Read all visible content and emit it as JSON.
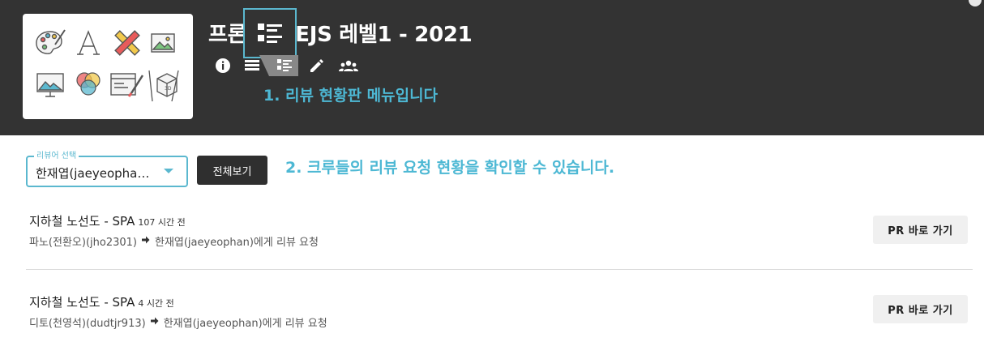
{
  "header": {
    "title": "프론트엔드 TDD & BDD REACT / NODEJS 레벨1 - 2021",
    "title_visible_left": "프론",
    "title_visible_right": "EJS 레벨1 - 2021",
    "tools": [
      {
        "name": "info",
        "icon": "info-icon"
      },
      {
        "name": "list-view",
        "icon": "view-list-icon"
      },
      {
        "name": "review-board",
        "icon": "review-board-icon"
      },
      {
        "name": "edit",
        "icon": "pencil-icon"
      },
      {
        "name": "members",
        "icon": "people-icon"
      }
    ]
  },
  "annotations": {
    "step1": "1. 리뷰 현황판 메뉴입니다",
    "step2": "2. 크루들의 리뷰 요청 현황을 확인할 수 있습니다."
  },
  "filter": {
    "select_label": "리뷰어 선택",
    "select_value": "한재엽(jaeyeopha…",
    "all_button": "전체보기"
  },
  "reviews": [
    {
      "title": "지하철 노선도 - SPA",
      "time": "107 시간 전",
      "requester": "파노(전환오)(jho2301)",
      "target": "한재엽(jaeyeophan)에게 리뷰 요청",
      "button": "PR 바로 가기"
    },
    {
      "title": "지하철 노선도 - SPA",
      "time": "4 시간 전",
      "requester": "디토(천영석)(dudtjr913)",
      "target": "한재엽(jaeyeophan)에게 리뷰 요청",
      "button": "PR 바로 가기"
    }
  ],
  "colors": {
    "header_bg": "#333333",
    "accent": "#4db8d4",
    "button_dark": "#2f2f2f",
    "button_light": "#f0f0f0"
  }
}
